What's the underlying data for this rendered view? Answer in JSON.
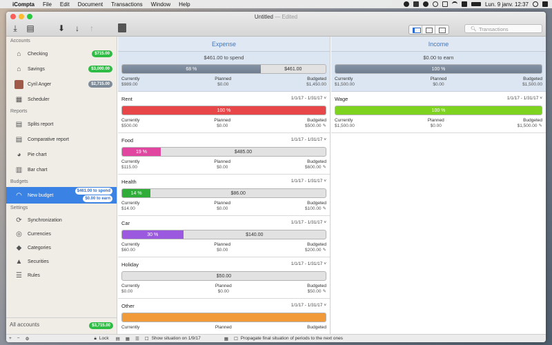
{
  "menubar": {
    "app": "iCompta",
    "items": [
      "File",
      "Edit",
      "Document",
      "Transactions",
      "Window",
      "Help"
    ],
    "clock": "Lun. 9 janv.  12:37"
  },
  "window": {
    "title": "Untitled",
    "edited": "— Edited"
  },
  "search": {
    "placeholder": "Transactions"
  },
  "sidebar": {
    "accounts_header": "Accounts",
    "accounts": [
      {
        "label": "Checking",
        "badge": "$715.00",
        "color": "#2fbc44"
      },
      {
        "label": "Savings",
        "badge": "$3,000.00",
        "color": "#2fbc44"
      },
      {
        "label": "Cyril Anger",
        "badge": "$2,715.00",
        "color": "#7e8b99"
      },
      {
        "label": "Scheduler"
      }
    ],
    "reports_header": "Reports",
    "reports": [
      "Splits report",
      "Comparative report",
      "Pie chart",
      "Bar chart"
    ],
    "budgets_header": "Budgets",
    "budget": {
      "label": "New budget",
      "spend": "$461.00 to spend",
      "earn": "$0.00 to earn"
    },
    "settings_header": "Settings",
    "settings": [
      "Synchronization",
      "Currencies",
      "Categories",
      "Securities",
      "Rules"
    ],
    "all_accounts": "All accounts",
    "all_badge": "$3,715.00",
    "lock": "Lock"
  },
  "bottombar": {
    "show_situation": "Show situation on 1/9/17",
    "propagate": "Propagate final situation of periods to the next ones"
  },
  "labels": {
    "currently": "Currently",
    "planned": "Planned",
    "budgeted": "Budgeted"
  },
  "expense": {
    "header": "Expense",
    "summary": {
      "text": "$461.00 to spend",
      "percent_label": "68 %",
      "remaining": "$461.00",
      "percent": 0.68,
      "currently": "$989.00",
      "planned": "$0.00",
      "budgeted": "$1,450.00"
    },
    "items": [
      {
        "name": "Rent",
        "dates": "1/1/17 - 1/31/17",
        "percent": 1.0,
        "label": "100 %",
        "rest": "",
        "color": "#e8474a",
        "currently": "$500.00",
        "planned": "$0.00",
        "budgeted": "$500.00"
      },
      {
        "name": "Food",
        "dates": "1/1/17 - 1/31/17",
        "percent": 0.19,
        "label": "19 %",
        "rest": "$485.00",
        "color": "#e0469f",
        "currently": "$115.00",
        "planned": "$0.00",
        "budgeted": "$600.00"
      },
      {
        "name": "Health",
        "dates": "1/1/17 - 1/31/17",
        "percent": 0.14,
        "label": "14 %",
        "rest": "$86.00",
        "color": "#30ad39",
        "currently": "$14.00",
        "planned": "$0.00",
        "budgeted": "$100.00"
      },
      {
        "name": "Car",
        "dates": "1/1/17 - 1/31/17",
        "percent": 0.3,
        "label": "30 %",
        "rest": "$140.00",
        "color": "#9a59de",
        "currently": "$60.00",
        "planned": "$0.00",
        "budgeted": "$200.00"
      },
      {
        "name": "Holiday",
        "dates": "1/1/17 - 1/31/17",
        "percent": 0,
        "label": "",
        "rest": "$50.00",
        "color": "#999999",
        "currently": "$0.00",
        "planned": "$0.00",
        "budgeted": "$50.00"
      },
      {
        "name": "Other",
        "dates": "1/1/17 - 1/31/17",
        "percent": 1.0,
        "label": "",
        "rest": "",
        "color": "#f09a3a",
        "currently": "",
        "planned": "",
        "budgeted": ""
      }
    ]
  },
  "income": {
    "header": "Income",
    "summary": {
      "text": "$0.00 to earn",
      "percent_label": "100 %",
      "percent": 1.0,
      "currently": "$1,500.00",
      "planned": "$0.00",
      "budgeted": "$1,500.00"
    },
    "items": [
      {
        "name": "Wage",
        "dates": "1/1/17 - 1/31/17",
        "percent": 1.0,
        "label": "100 %",
        "color": "#7ed321",
        "currently": "$1,500.00",
        "planned": "$0.00",
        "budgeted": "$1,500.00"
      }
    ]
  }
}
